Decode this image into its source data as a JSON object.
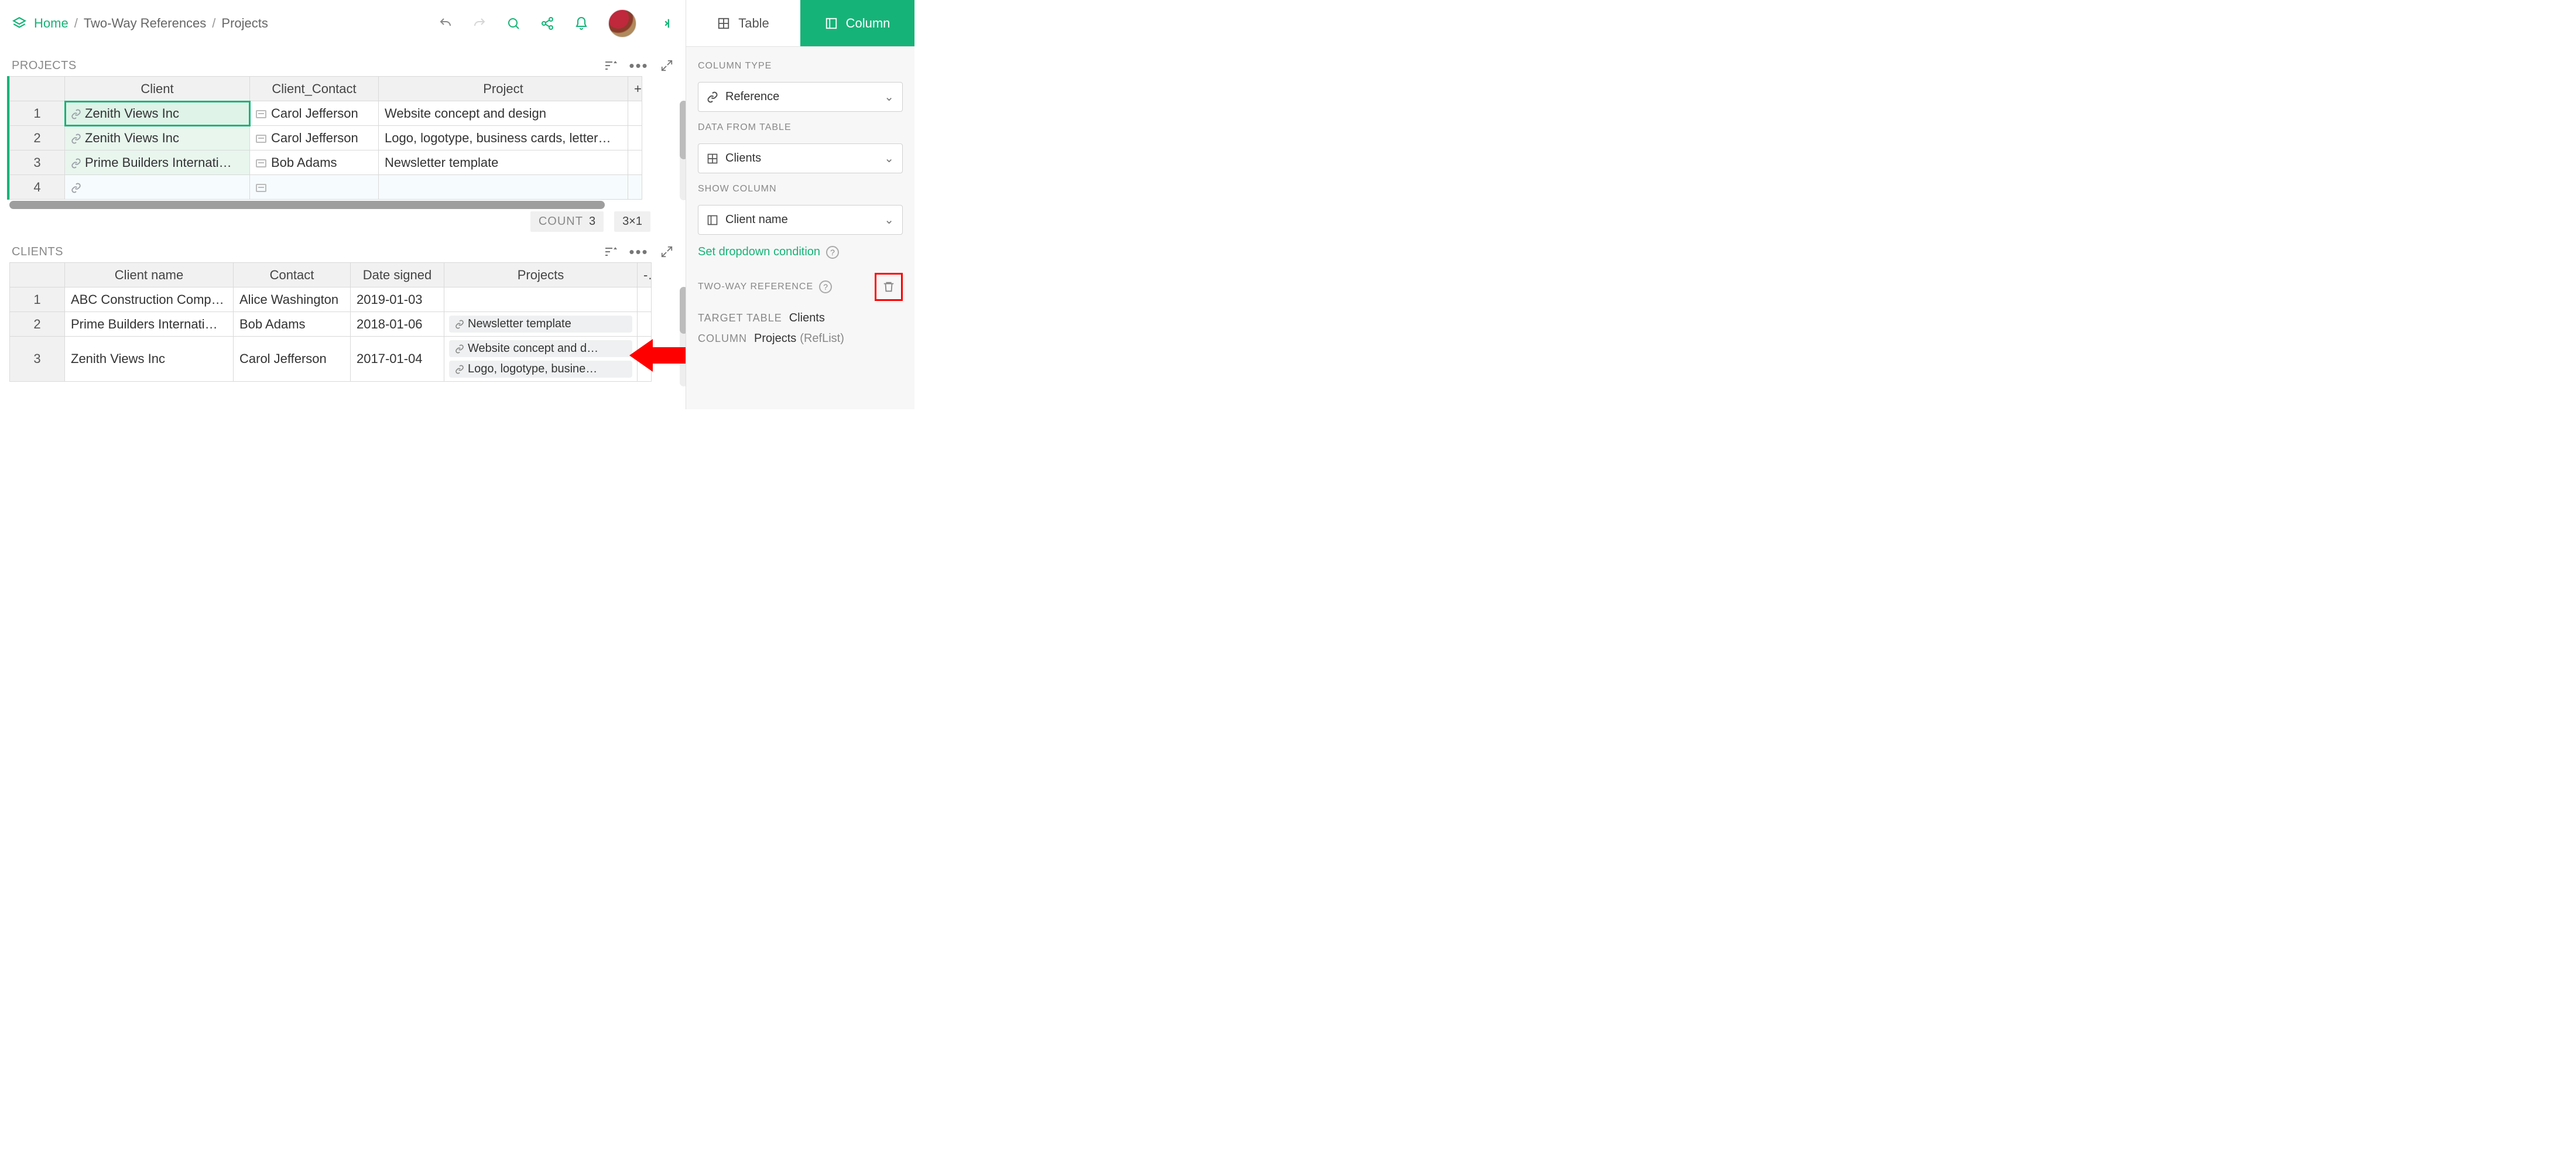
{
  "breadcrumbs": {
    "home": "Home",
    "doc": "Two-Way References",
    "page": "Projects"
  },
  "sections": {
    "projects": {
      "title": "PROJECTS",
      "columns": [
        "Client",
        "Client_Contact",
        "Project"
      ],
      "rows": [
        {
          "n": "1",
          "client": "Zenith Views Inc",
          "contact": "Carol Jefferson",
          "project": "Website concept and design"
        },
        {
          "n": "2",
          "client": "Zenith Views Inc",
          "contact": "Carol Jefferson",
          "project": "Logo, logotype, business cards, letter…"
        },
        {
          "n": "3",
          "client": "Prime Builders Internati…",
          "contact": "Bob Adams",
          "project": "Newsletter template"
        },
        {
          "n": "4",
          "client": "",
          "contact": "",
          "project": ""
        }
      ],
      "stats": {
        "count_label": "COUNT",
        "count": "3",
        "dims": "3×1"
      },
      "plus": "+"
    },
    "clients": {
      "title": "CLIENTS",
      "columns": [
        "Client name",
        "Contact",
        "Date signed",
        "Projects"
      ],
      "rows": [
        {
          "n": "1",
          "name": "ABC Construction Comp…",
          "contact": "Alice Washington",
          "date": "2019-01-03",
          "projects": []
        },
        {
          "n": "2",
          "name": "Prime Builders Internati…",
          "contact": "Bob Adams",
          "date": "2018-01-06",
          "projects": [
            "Newsletter template"
          ]
        },
        {
          "n": "3",
          "name": "Zenith Views Inc",
          "contact": "Carol Jefferson",
          "date": "2017-01-04",
          "projects": [
            "Website concept and d…",
            "Logo, logotype, busine…"
          ]
        }
      ],
      "plus": "-"
    }
  },
  "sidebar": {
    "tab_table": "Table",
    "tab_column": "Column",
    "column_type_label": "COLUMN TYPE",
    "column_type_value": "Reference",
    "data_from_label": "DATA FROM TABLE",
    "data_from_value": "Clients",
    "show_column_label": "SHOW COLUMN",
    "show_column_value": "Client name",
    "dropdown_link": "Set dropdown condition",
    "two_way_label": "TWO-WAY REFERENCE",
    "target_table_label": "TARGET TABLE",
    "target_table_value": "Clients",
    "column_label": "COLUMN",
    "column_value": "Projects",
    "column_suffix": "(RefList)"
  }
}
